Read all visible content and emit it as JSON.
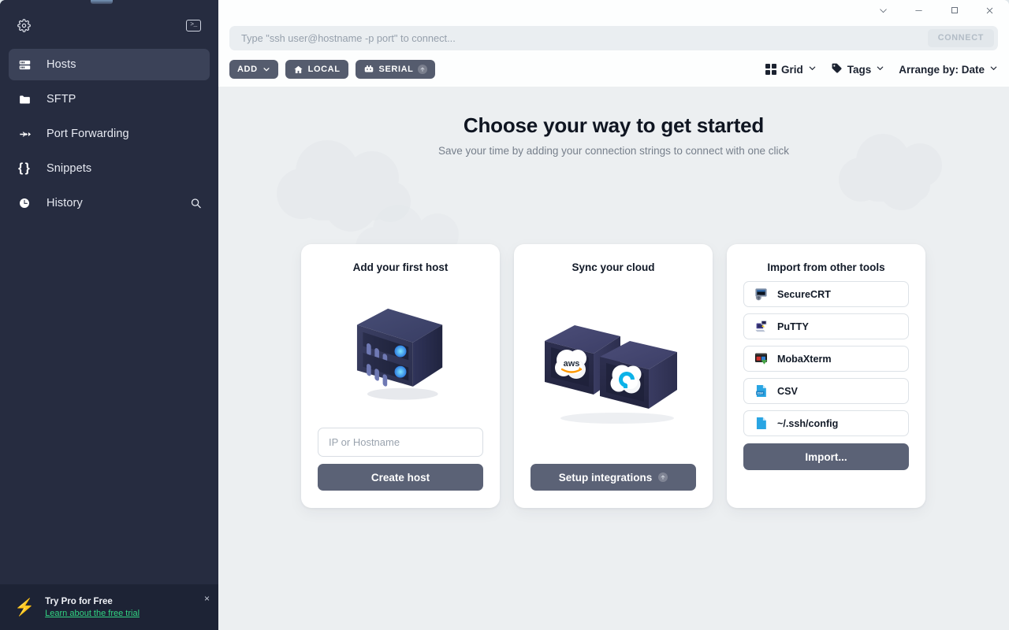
{
  "window": {
    "controls": [
      {
        "name": "chevron-down",
        "glyph": "⌄"
      },
      {
        "name": "minimize",
        "glyph": "—"
      },
      {
        "name": "maximize",
        "glyph": "□"
      },
      {
        "name": "close",
        "glyph": "✕"
      }
    ]
  },
  "sidebar": {
    "gear_icon": "gear-icon",
    "terminal_icon": "terminal-icon",
    "terminal_glyph": ">_",
    "items": [
      {
        "label": "Hosts",
        "icon": "server-icon",
        "active": true
      },
      {
        "label": "SFTP",
        "icon": "folder-icon",
        "active": false
      },
      {
        "label": "Port Forwarding",
        "icon": "arrows-icon",
        "active": false
      },
      {
        "label": "Snippets",
        "icon": "braces-icon",
        "active": false
      },
      {
        "label": "History",
        "icon": "clock-icon",
        "active": false,
        "trailing_icon": "search-icon"
      }
    ],
    "promo": {
      "title": "Try Pro for Free",
      "link": "Learn about the free trial",
      "bolt_icon": "bolt-icon",
      "close_label": "×",
      "link_color": "#32d583",
      "bolt_color": "#f2c94c"
    }
  },
  "search": {
    "placeholder": "Type \"ssh user@hostname -p port\" to connect...",
    "value": "",
    "connect_label": "CONNECT"
  },
  "toolbar": {
    "add_label": "ADD",
    "add_caret": "⌄",
    "local_label": "LOCAL",
    "local_icon": "home-icon",
    "serial_label": "SERIAL",
    "serial_icon": "usb-icon",
    "serial_badge": "⬆",
    "grid_label": "Grid",
    "grid_icon": "grid-icon",
    "grid_caret": "⌄",
    "tags_label": "Tags",
    "tags_icon": "tag-icon",
    "tags_caret": "⌄",
    "arrange_label": "Arrange by: Date",
    "arrange_caret": "⌄"
  },
  "main": {
    "title": "Choose your way to get started",
    "subtitle": "Save your time by adding your connection strings to connect with one click",
    "cards": [
      {
        "title": "Add your first host",
        "art": "server-illustration",
        "input_placeholder": "IP or Hostname",
        "input_value": "",
        "button_label": "Create host"
      },
      {
        "title": "Sync your cloud",
        "art": "cloud-boxes-illustration",
        "button_label": "Setup integrations",
        "button_badge": "pro-badge-icon"
      },
      {
        "title": "Import from other tools",
        "items": [
          {
            "label": "SecureCRT",
            "icon": "securecrt-icon"
          },
          {
            "label": "PuTTY",
            "icon": "putty-icon"
          },
          {
            "label": "MobaXterm",
            "icon": "mobaxterm-icon"
          },
          {
            "label": "CSV",
            "icon": "csv-file-icon"
          },
          {
            "label": "~/.ssh/config",
            "icon": "file-icon"
          }
        ],
        "button_label": "Import..."
      }
    ]
  },
  "colors": {
    "sidebar_bg": "#262c40",
    "sidebar_active": "#3b4258",
    "content_bg": "#eceff1",
    "accent_button": "#5b6276",
    "pill_bg": "#555c6e"
  }
}
